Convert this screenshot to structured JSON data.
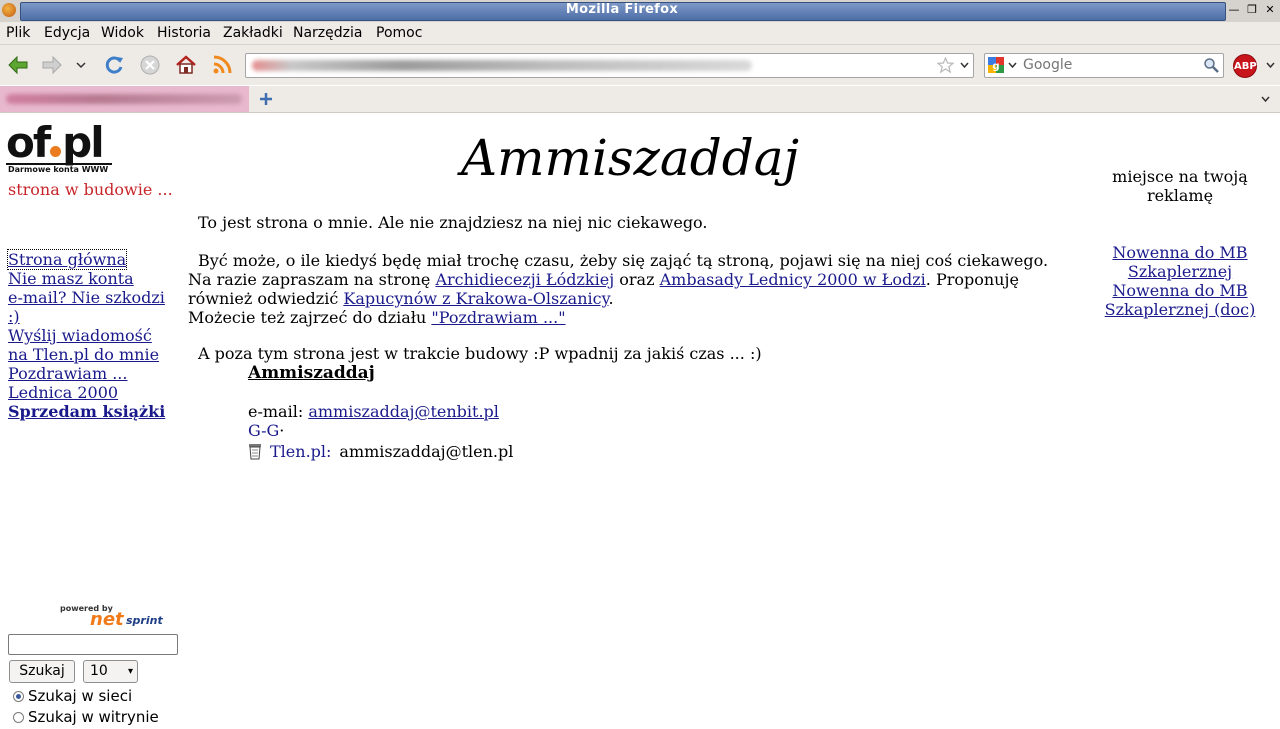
{
  "window": {
    "title": "Mozilla Firefox"
  },
  "menu": [
    "Plik",
    "Edycja",
    "Widok",
    "Historia",
    "Zakładki",
    "Narzędzia",
    "Pomoc"
  ],
  "search": {
    "placeholder": "Google"
  },
  "addons": {
    "abp": "ABP"
  },
  "site": {
    "logo_text_a": "of",
    "logo_text_b": "pl",
    "logo_sub": "Darmowe konta WWW",
    "status": "strona w budowie ...",
    "nav": {
      "home": "Strona główna",
      "email_1": "Nie masz konta",
      "email_2": "e-mail? Nie szkodzi",
      "email_3": ":)",
      "tlen_1": "Wyślij wiadomość",
      "tlen_2": "na Tlen.pl do mnie",
      "greet": "Pozdrawiam ...",
      "lednica": "Lednica 2000",
      "books": "Sprzedam książki"
    },
    "title": "Ammiszaddaj",
    "p1": "To jest strona o mnie. Ale nie znajdziesz na niej nic ciekawego.",
    "p2_a": "Być może, o ile kiedyś będę miał trochę czasu, żeby się zająć tą stroną, pojawi się na niej coś ciekawego.",
    "p2_b": "Na razie zapraszam na stronę",
    "link_archi": "Archidiecezji Łódzkiej",
    "p2_c": "oraz",
    "link_ambasada": "Ambasady Lednicy 2000 w Łodzi",
    "p2_d": ". Proponuję",
    "p2_e": "również odwiedzić",
    "link_kapucyni": "Kapucynów z Krakowa-Olszanicy",
    "p2_f": ".",
    "p2_g": "Możecie też zajrzeć do działu",
    "link_pozdrawiam": "\"Pozdrawiam ...\"",
    "p3": "A poza tym strona jest w trakcie budowy :P wpadnij za jakiś czas ... :)",
    "contact": {
      "name": "Ammiszaddaj",
      "email_label": "e-mail:",
      "email": "ammiszaddaj@tenbit.pl",
      "gg": "G-G",
      "gg_after": "·",
      "tlen_label": "Tlen.pl:",
      "tlen": "ammiszaddaj@tlen.pl"
    },
    "ads": {
      "placeholder_1": "miejsce na twoją",
      "placeholder_2": "reklamę",
      "link1_a": "Nowenna do MB",
      "link1_b": "Szkaplerznej",
      "link2_a": "Nowenna do MB",
      "link2_b": "Szkaplerznej (doc)"
    },
    "netsprint": {
      "powered": "powered by",
      "net": "net",
      "sprint": "sprint"
    },
    "searchform": {
      "button": "Szukaj",
      "count": "10",
      "opt_web": "Szukaj w sieci",
      "opt_site": "Szukaj w witrynie"
    }
  }
}
